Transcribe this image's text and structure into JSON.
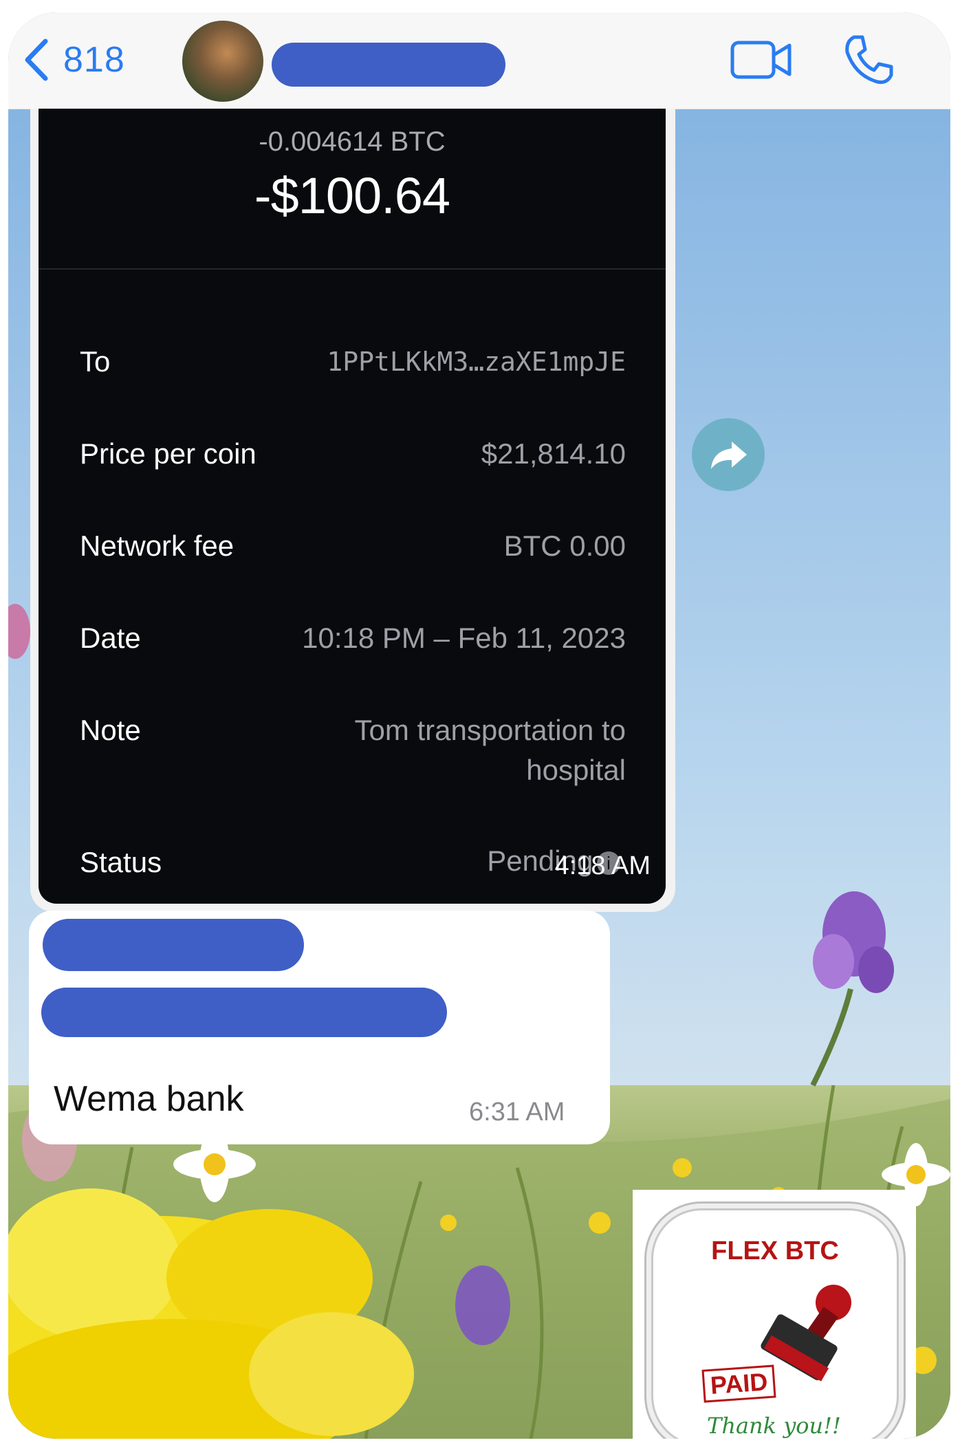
{
  "header": {
    "back_count": "818",
    "icons": {
      "back": "chevron-left-icon",
      "video": "video-camera-icon",
      "call": "phone-icon"
    },
    "accent_color": "#2a7cf0"
  },
  "transaction": {
    "btc_amount": "-0.004614 BTC",
    "usd_amount": "-$100.64",
    "rows": [
      {
        "label": "To",
        "value": "1PPtLKkM3…zaXE1mpJE"
      },
      {
        "label": "Price per coin",
        "value": "$21,814.10"
      },
      {
        "label": "Network fee",
        "value": "BTC 0.00"
      },
      {
        "label": "Date",
        "value": "10:18 PM – Feb 11, 2023"
      },
      {
        "label": "Note",
        "value": "Tom transportation to",
        "value2": "hospital"
      },
      {
        "label": "Status",
        "value": "Pending"
      }
    ],
    "timestamp": "4:18 AM"
  },
  "message2": {
    "text": "Wema bank",
    "timestamp": "6:31 AM"
  },
  "sticker": {
    "title": "FLEX BTC",
    "stamp_text": "PAID",
    "thanks": "Thank you!!"
  }
}
